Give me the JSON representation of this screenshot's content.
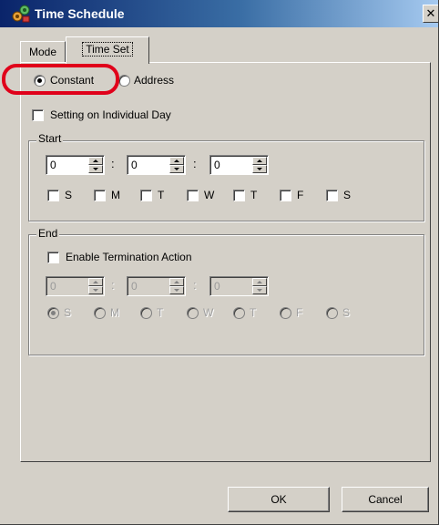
{
  "window": {
    "title": "Time Schedule",
    "close_glyph": "✕"
  },
  "tabs": [
    {
      "label": "Mode"
    },
    {
      "label": "Time Set"
    }
  ],
  "source": {
    "constant_label": "Constant",
    "address_label": "Address",
    "selected": "Constant"
  },
  "individual_day": {
    "label": "Setting on Individual Day",
    "checked": false
  },
  "start": {
    "legend": "Start",
    "hour": "0",
    "minute": "0",
    "second": "0",
    "days": [
      "S",
      "M",
      "T",
      "W",
      "T",
      "F",
      "S"
    ]
  },
  "end": {
    "legend": "End",
    "enable_label": "Enable Termination Action",
    "enabled": false,
    "hour": "0",
    "minute": "0",
    "second": "0",
    "days": [
      "S",
      "M",
      "T",
      "W",
      "T",
      "F",
      "S"
    ],
    "selected_day_index": 0
  },
  "buttons": {
    "ok": "OK",
    "cancel": "Cancel"
  },
  "colors": {
    "highlight": "#e0001a",
    "face": "#d4d0c8",
    "title_start": "#0a246a"
  },
  "icons": {
    "title": "gear-cluster-icon"
  }
}
